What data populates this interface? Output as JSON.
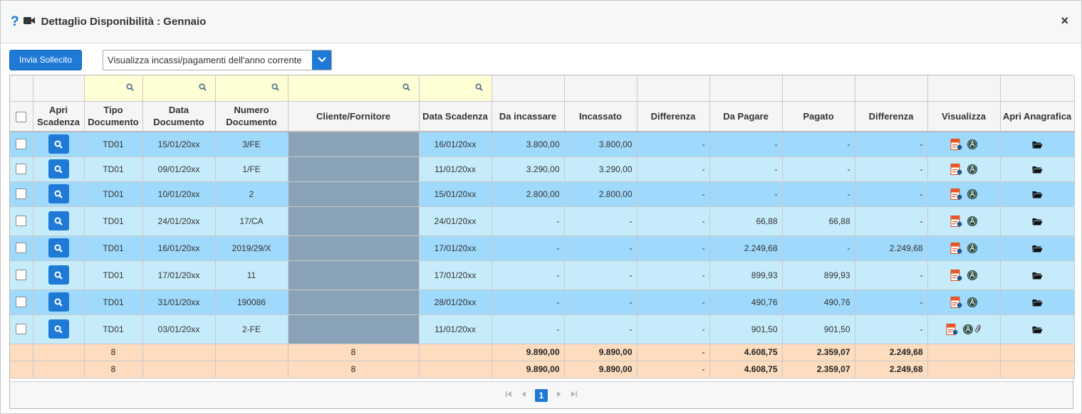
{
  "dialog": {
    "title": "Dettaglio Disponibilità : Gennaio",
    "help_glyph": "?",
    "close_glyph": "×"
  },
  "toolbar": {
    "send_reminder_label": "Invia Sollecito",
    "filter_select_value": "Visualizza incassi/pagamenti dell'anno corrente"
  },
  "columns": {
    "apri_scadenza": "Apri Scadenza",
    "tipo_documento": "Tipo Documento",
    "data_documento": "Data Documento",
    "numero_documento": "Numero Documento",
    "cliente_fornitore": "Cliente/Fornitore",
    "data_scadenza": "Data Scadenza",
    "da_incassare": "Da incassare",
    "incassato": "Incassato",
    "differenza_1": "Differenza",
    "da_pagare": "Da Pagare",
    "pagato": "Pagato",
    "differenza_2": "Differenza",
    "visualizza": "Visualizza",
    "apri_anagrafica": "Apri Anagrafica"
  },
  "rows": [
    {
      "tipo": "TD01",
      "data_doc": "15/01/20xx",
      "numero": "3/FE",
      "scadenza": "16/01/20xx",
      "da_incassare": "3.800,00",
      "incassato": "3.800,00",
      "diff1": "-",
      "da_pagare": "-",
      "pagato": "-",
      "diff2": "-",
      "attachment": false
    },
    {
      "tipo": "TD01",
      "data_doc": "09/01/20xx",
      "numero": "1/FE",
      "scadenza": "11/01/20xx",
      "da_incassare": "3.290,00",
      "incassato": "3.290,00",
      "diff1": "-",
      "da_pagare": "-",
      "pagato": "-",
      "diff2": "-",
      "attachment": false
    },
    {
      "tipo": "TD01",
      "data_doc": "10/01/20xx",
      "numero": "2",
      "scadenza": "15/01/20xx",
      "da_incassare": "2.800,00",
      "incassato": "2.800,00",
      "diff1": "-",
      "da_pagare": "-",
      "pagato": "-",
      "diff2": "-",
      "attachment": false
    },
    {
      "tipo": "TD01",
      "data_doc": "24/01/20xx",
      "numero": "17/CA",
      "scadenza": "24/01/20xx",
      "da_incassare": "-",
      "incassato": "-",
      "diff1": "-",
      "da_pagare": "66,88",
      "pagato": "66,88",
      "diff2": "-",
      "attachment": false
    },
    {
      "tipo": "TD01",
      "data_doc": "16/01/20xx",
      "numero": "2019/29/X",
      "scadenza": "17/01/20xx",
      "da_incassare": "-",
      "incassato": "-",
      "diff1": "-",
      "da_pagare": "2.249,68",
      "pagato": "-",
      "diff2": "2.249,68",
      "attachment": false
    },
    {
      "tipo": "TD01",
      "data_doc": "17/01/20xx",
      "numero": "11",
      "scadenza": "17/01/20xx",
      "da_incassare": "-",
      "incassato": "-",
      "diff1": "-",
      "da_pagare": "899,93",
      "pagato": "899,93",
      "diff2": "-",
      "attachment": false
    },
    {
      "tipo": "TD01",
      "data_doc": "31/01/20xx",
      "numero": "190086",
      "scadenza": "28/01/20xx",
      "da_incassare": "-",
      "incassato": "-",
      "diff1": "-",
      "da_pagare": "490,76",
      "pagato": "490,76",
      "diff2": "-",
      "attachment": false
    },
    {
      "tipo": "TD01",
      "data_doc": "03/01/20xx",
      "numero": "2-FE",
      "scadenza": "11/01/20xx",
      "da_incassare": "-",
      "incassato": "-",
      "diff1": "-",
      "da_pagare": "901,50",
      "pagato": "901,50",
      "diff2": "-",
      "attachment": true
    }
  ],
  "totals": [
    {
      "tipo_count": "8",
      "cliente_count": "8",
      "da_incassare": "9.890,00",
      "incassato": "9.890,00",
      "diff1": "-",
      "da_pagare": "4.608,75",
      "pagato": "2.359,07",
      "diff2": "2.249,68"
    },
    {
      "tipo_count": "8",
      "cliente_count": "8",
      "da_incassare": "9.890,00",
      "incassato": "9.890,00",
      "diff1": "-",
      "da_pagare": "4.608,75",
      "pagato": "2.359,07",
      "diff2": "2.249,68"
    }
  ],
  "pager": {
    "current_page": "1"
  },
  "colors": {
    "accent": "#1e7ad6",
    "row_a": "#9fd9fb",
    "row_b": "#c6ecfb",
    "totals": "#fddcc0",
    "filter": "#ffffd6"
  },
  "icons": {
    "help": "question-mark-icon",
    "title": "video-camera-icon",
    "close": "close-icon",
    "filter": "search-icon",
    "open_deadline": "search-icon",
    "view_document": "pdf-document-icon",
    "view_xml": "agenzia-entrate-icon",
    "attachment": "paperclip-icon",
    "open_registry": "folder-open-icon"
  }
}
